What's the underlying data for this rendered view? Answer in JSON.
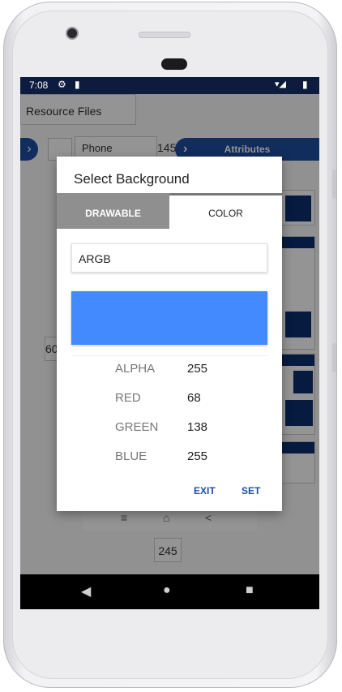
{
  "status_bar": {
    "time": "7:08",
    "settings_icon": "⚙",
    "sd_icon": "▮",
    "wifi_icon": "▾◢",
    "battery_icon": "▮"
  },
  "background_app": {
    "resource_files": "Resource Files",
    "phone_field": "Phone",
    "number_145": "145",
    "attributes": "Attributes",
    "number_60": "60",
    "number_245": "245",
    "nav_menu": "≡",
    "nav_home": "⌂",
    "nav_back": "<"
  },
  "dialog": {
    "title": "Select Background",
    "tabs": [
      {
        "label": "DRAWABLE"
      },
      {
        "label": "COLOR"
      }
    ],
    "selected_tab": "COLOR",
    "format_input": "ARGB",
    "swatch_color": "#448AFF",
    "channels": [
      {
        "label": "ALPHA",
        "value": "255"
      },
      {
        "label": "RED",
        "value": "68"
      },
      {
        "label": "GREEN",
        "value": "138"
      },
      {
        "label": "BLUE",
        "value": "255"
      }
    ],
    "exit_label": "EXIT",
    "set_label": "SET"
  },
  "nav_bar": {
    "back_icon": "◀",
    "home_icon": "●",
    "recents_icon": "■"
  }
}
